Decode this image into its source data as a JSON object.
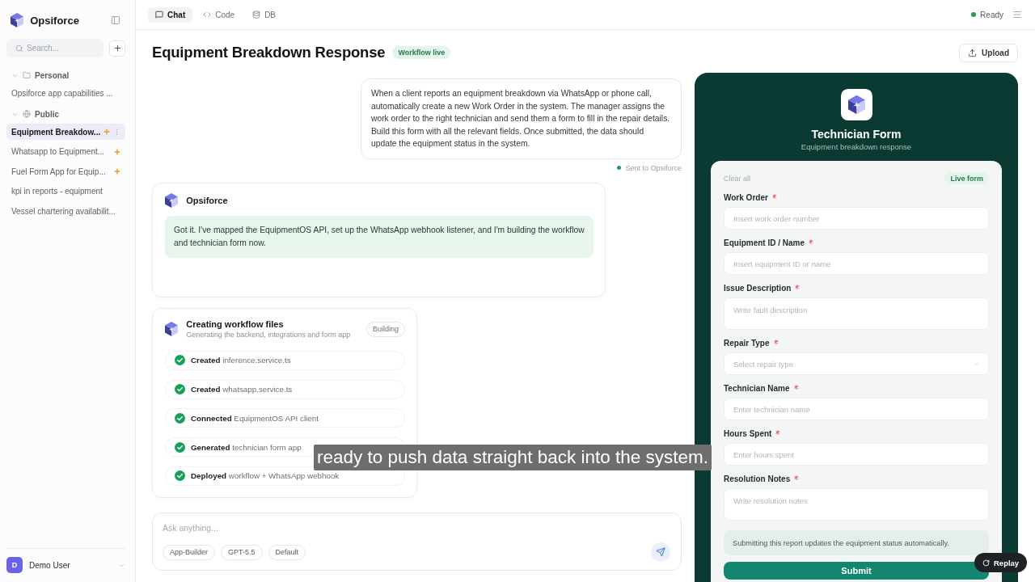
{
  "sidebar": {
    "brand": "Opsiforce",
    "search": {
      "placeholder": "Search..."
    },
    "groups": [
      {
        "label": "Personal",
        "expanded": true,
        "items": [
          {
            "label": "Opsiforce app capabilities ...",
            "selected": false,
            "starred": false
          }
        ]
      },
      {
        "label": "Public",
        "expanded": true,
        "items": [
          {
            "label": "Equipment Breakdow...",
            "selected": true,
            "starred": true
          },
          {
            "label": "Whatsapp to Equipment...",
            "selected": false,
            "starred": true
          },
          {
            "label": "Fuel Form App for Equip...",
            "selected": false,
            "starred": true
          },
          {
            "label": "kpi in reports - equipment",
            "selected": false,
            "starred": false
          },
          {
            "label": "Vessel chartering availabilit...",
            "selected": false,
            "starred": false
          }
        ]
      }
    ],
    "user": {
      "initial": "D",
      "name": "Demo User"
    }
  },
  "top_bar": {
    "tabs": [
      {
        "label": "Chat",
        "selected": true
      },
      {
        "label": "Code",
        "selected": false
      },
      {
        "label": "DB",
        "selected": false
      }
    ],
    "status": "Ready"
  },
  "header": {
    "title": "Equipment Breakdown Response",
    "badge": "Workflow live",
    "upload_button": "Upload"
  },
  "chat": {
    "messages": [
      {
        "kind": "user",
        "text": "When a client reports an equipment breakdown via WhatsApp or phone call, automatically create a new Work Order in the system. The manager assigns the work order to the right technician and send them a form to fill in the repair details. Build this form with all the relevant fields. Once submitted, the data should update the equipment status in the system.",
        "status": "Sent to Opsiforce"
      },
      {
        "kind": "assistant",
        "sender": "Opsiforce",
        "text": "Got it. I've mapped the EquipmentOS API, set up the WhatsApp webhook listener, and I'm building the workflow and technician form now."
      }
    ],
    "task": {
      "title": "Creating workflow files",
      "subtitle": "Generating the backend, integrations and form app",
      "badge": "Building",
      "steps": [
        {
          "action": "Created",
          "target": "inference.service.ts",
          "done": true
        },
        {
          "action": "Created",
          "target": "whatsapp.service.ts",
          "done": true
        },
        {
          "action": "Connected",
          "target": "EquipmentOS API client",
          "done": true
        },
        {
          "action": "Generated",
          "target": "technician form app",
          "done": true
        },
        {
          "action": "Deployed",
          "target": "workflow + WhatsApp webhook",
          "done": true
        }
      ]
    }
  },
  "composer": {
    "placeholder": "Ask anything...",
    "chips": [
      "App-Builder",
      "GPT-5.5",
      "Default"
    ]
  },
  "form_panel": {
    "title": "Technician Form",
    "subtitle": "Equipment breakdown response",
    "clear_label": "Clear all",
    "badge": "Live form",
    "fields": [
      {
        "label": "Work Order",
        "required": true,
        "kind": "input",
        "placeholder": "Insert work order number"
      },
      {
        "label": "Equipment ID / Name",
        "required": true,
        "kind": "input",
        "placeholder": "Insert equipment ID or name"
      },
      {
        "label": "Issue Description",
        "required": true,
        "kind": "textarea",
        "placeholder": "Write fault description"
      },
      {
        "label": "Repair Type",
        "required": true,
        "kind": "select",
        "placeholder": "Select repair type"
      },
      {
        "label": "Technician Name",
        "required": true,
        "kind": "input",
        "placeholder": "Enter technician name"
      },
      {
        "label": "Hours Spent",
        "required": true,
        "kind": "input",
        "placeholder": "Enter hours spent"
      },
      {
        "label": "Resolution Notes",
        "required": true,
        "kind": "textarea",
        "placeholder": "Write resolution notes"
      }
    ],
    "note": "Submitting this report updates the equipment status automatically.",
    "submit_button": "Submit"
  },
  "caption": "ready to push data straight back into the system.",
  "replay_button": "Replay"
}
